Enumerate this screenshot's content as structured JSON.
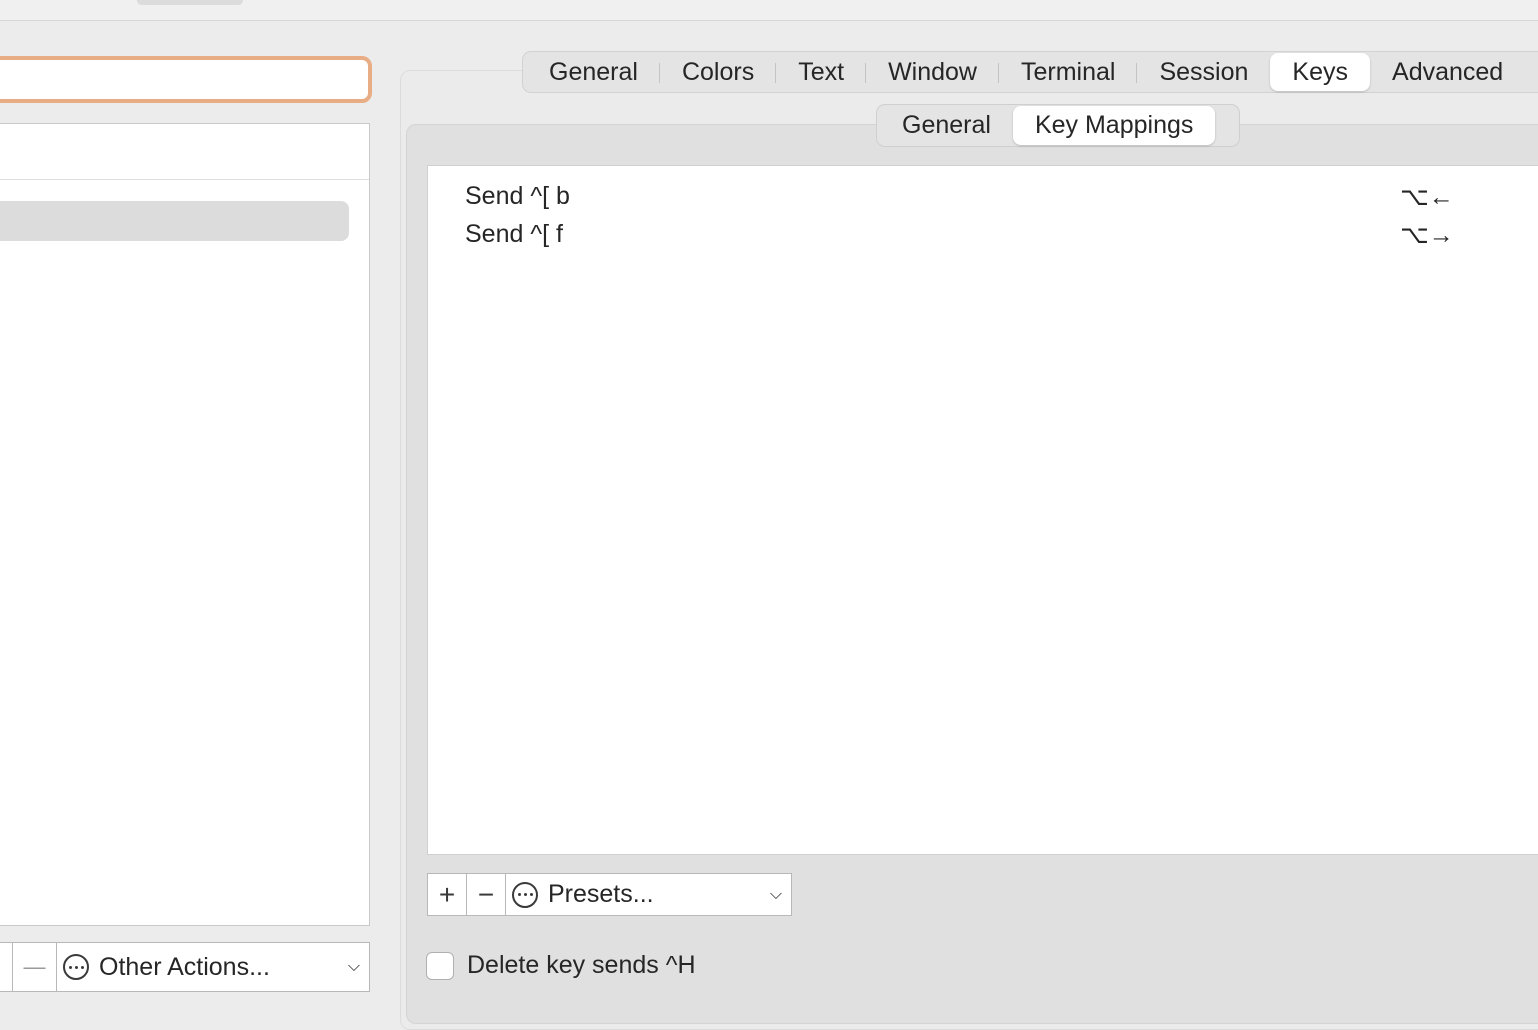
{
  "main_tabs": [
    "General",
    "Colors",
    "Text",
    "Window",
    "Terminal",
    "Session",
    "Keys",
    "Advanced"
  ],
  "main_tab_active": "Keys",
  "sub_tabs": [
    "General",
    "Key Mappings"
  ],
  "sub_tab_active": "Key Mappings",
  "key_mappings": [
    {
      "action": "Send ^[ b",
      "shortcut": "⌥←"
    },
    {
      "action": "Send ^[ f",
      "shortcut": "⌥→"
    }
  ],
  "table_toolbar": {
    "add_label": "+",
    "remove_label": "−",
    "presets_label": "Presets..."
  },
  "delete_key_checkbox": {
    "label": "Delete key sends ^H",
    "checked": false
  },
  "left_toolbar": {
    "remove_label": "—",
    "other_actions_label": "Other Actions..."
  },
  "colors": {
    "focus_ring": "#e8ad85",
    "selected_tab_bg": "#ffffff"
  }
}
